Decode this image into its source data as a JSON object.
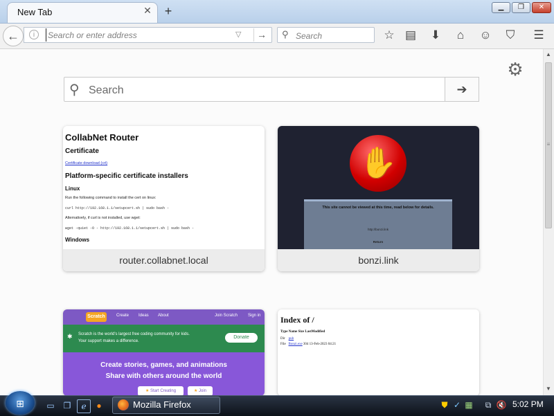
{
  "browser": {
    "tab_title": "New Tab",
    "tab_close": "✕",
    "new_tab": "+",
    "window_min": "▁",
    "window_max": "❐",
    "window_close": "✕",
    "back": "←",
    "url_placeholder": "Search or enter address",
    "url_go": "→",
    "url_dropdown": "▽",
    "search_placeholder": "Search",
    "icons": [
      "star-icon",
      "reading-list-icon",
      "download-icon",
      "home-icon",
      "hello-icon",
      "pocket-icon",
      "menu-icon"
    ]
  },
  "newtab": {
    "settings_icon": "⚙",
    "search_placeholder": "Search",
    "search_go": "➔",
    "tiles": [
      {
        "label": "router.collabnet.local"
      },
      {
        "label": "bonzi.link"
      },
      {
        "label": ""
      },
      {
        "label": ""
      }
    ]
  },
  "collabnet": {
    "title": "CollabNet Router",
    "certificate": "Certificate",
    "cert_link": "Certificate download (crt)",
    "platform": "Platform-specific certificate installers",
    "linux": "Linux",
    "run_following": "Run the following command to install the cert on linux:",
    "curl_cmd": "curl http://192.168.1.1/setupcert.sh | sudo bash -",
    "alternatively": "Alternatively, if curl is not installed, use wget:",
    "wget_cmd": "wget -quiet -O - http://192.168.1.1/setupcert.sh | sudo bash -",
    "windows": "Windows"
  },
  "bonzi": {
    "message": "This site cannot be viewed at this time, read below for details.",
    "link": "http://bonzi.link",
    "return": "Return"
  },
  "scratch": {
    "logo": "Scratch",
    "nav": [
      "Create",
      "Ideas",
      "About",
      "Join Scratch",
      "Sign in"
    ],
    "banner_line1": "Scratch is the world's largest free coding community for kids.",
    "banner_line2": "Your support makes a difference.",
    "donate": "Donate",
    "headline1": "Create stories, games, and animations",
    "headline2": "Share with others around the world",
    "btn_start": "Start Creating",
    "btn_join": "Join"
  },
  "index": {
    "title": "Index of /",
    "headers": "Type  Name  Size  LastModified",
    "row1_type": "Dir",
    "row1_name": "pub",
    "row2_type": "File",
    "row2_name": "Bonzi.exe",
    "row2_rest": "304 13-Feb-2023 04:21"
  },
  "taskbar": {
    "task_label": "Mozilla Firefox",
    "clock": "5:02 PM"
  },
  "colors": {
    "accent": "#0a84ff",
    "scratch_purple": "#8857d9",
    "bonzi_red": "#d10000"
  }
}
